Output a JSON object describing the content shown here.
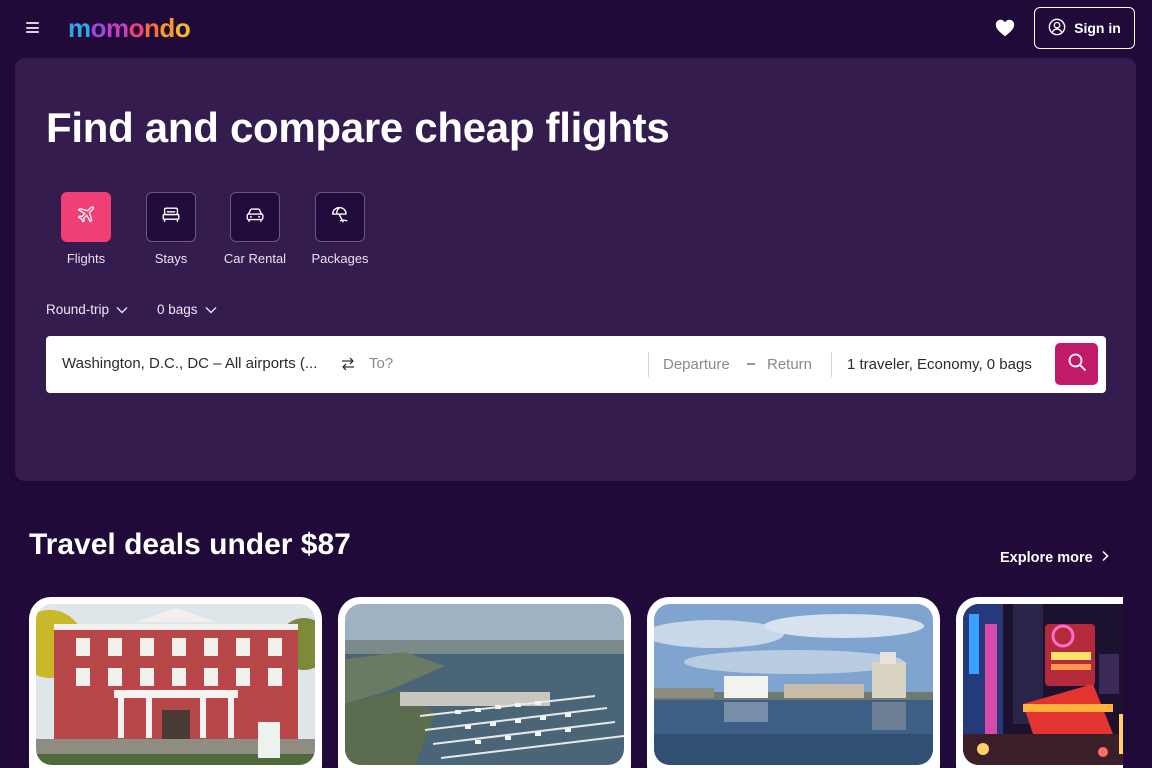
{
  "header": {
    "logo_letters": [
      "m",
      "o",
      "m",
      "o",
      "n",
      "d",
      "o"
    ],
    "logo_colors": [
      "#2fa6e6",
      "#9a49d6",
      "#c43fc0",
      "#ef3f74",
      "#f26d3f",
      "#f59b2c",
      "#f6b929"
    ],
    "sign_in_label": "Sign in",
    "icons": [
      "menu-icon",
      "heart-icon",
      "user-icon"
    ]
  },
  "hero": {
    "title": "Find and compare cheap flights",
    "verticals": [
      {
        "label": "Flights",
        "icon": "plane-icon",
        "active": true
      },
      {
        "label": "Stays",
        "icon": "bed-icon",
        "active": false
      },
      {
        "label": "Car Rental",
        "icon": "car-icon",
        "active": false
      },
      {
        "label": "Packages",
        "icon": "beach-umbrella-icon",
        "active": false
      }
    ],
    "trip_type": "Round-trip",
    "bags": "0 bags"
  },
  "search": {
    "origin": "Washington, D.C., DC – All airports (...",
    "destination_placeholder": "To?",
    "departure_placeholder": "Departure",
    "dash": "–",
    "return_placeholder": "Return",
    "travelers": "1 traveler, Economy, 0 bags"
  },
  "deals": {
    "title": "Travel deals under $87",
    "explore_label": "Explore more"
  },
  "colors": {
    "background": "#1f0a3a",
    "hero_card": "#341c4f",
    "accent_pink": "#ef3f74",
    "search_button": "#c21a6b"
  }
}
